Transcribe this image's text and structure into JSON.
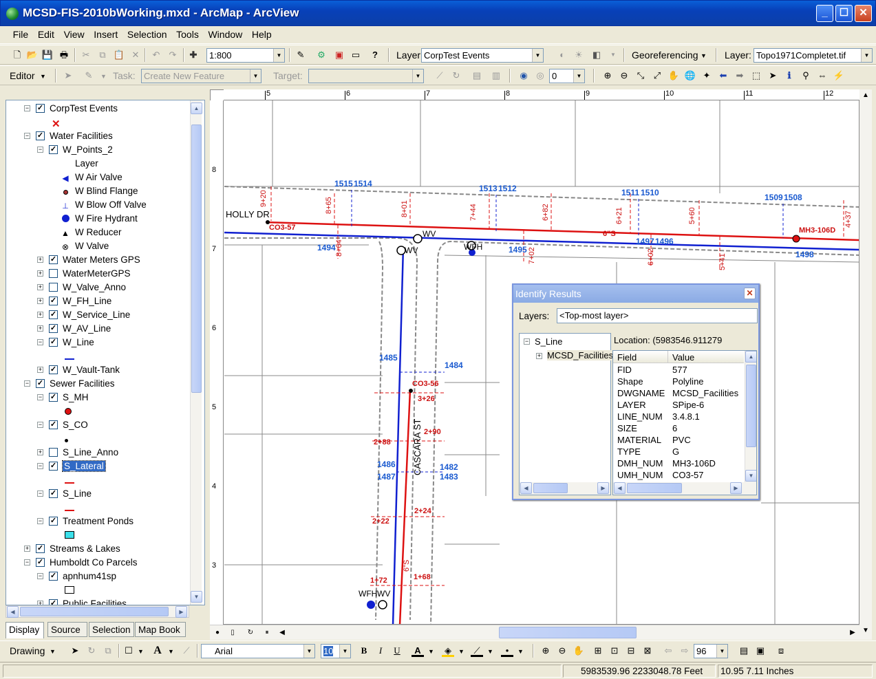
{
  "window": {
    "title": "MCSD-FIS-2010bWorking.mxd - ArcMap - ArcView"
  },
  "menu": [
    "File",
    "Edit",
    "View",
    "Insert",
    "Selection",
    "Tools",
    "Window",
    "Help"
  ],
  "standard_toolbar": {
    "scale": "1:800",
    "layer_label": "Layer",
    "layer_value": "CorpTest Events",
    "georef_label": "Georeferencing",
    "layer2_label": "Layer:",
    "layer2_value": "Topo1971Completet.tif"
  },
  "editor_toolbar": {
    "editor_label": "Editor",
    "task_label": "Task:",
    "task_value": "Create New Feature",
    "target_label": "Target:",
    "target_value": "",
    "snap_value": "0"
  },
  "toc": {
    "items": [
      {
        "label": "CorpTest Events",
        "level": 1,
        "expanded": true,
        "checked": true
      },
      {
        "label": "Water Facilities",
        "level": 1,
        "expanded": true,
        "checked": true
      },
      {
        "label": "W_Points_2",
        "level": 2,
        "expanded": true,
        "checked": true
      },
      {
        "label": "Layer",
        "level": 3,
        "legend": true
      },
      {
        "label": "W Air Valve",
        "level": 3,
        "legend": true
      },
      {
        "label": "W Blind Flange",
        "level": 3,
        "legend": true
      },
      {
        "label": "W Blow Off Valve",
        "level": 3,
        "legend": true
      },
      {
        "label": "W Fire Hydrant",
        "level": 3,
        "legend": true
      },
      {
        "label": "W Reducer",
        "level": 3,
        "legend": true
      },
      {
        "label": "W Valve",
        "level": 3,
        "legend": true
      },
      {
        "label": "Water Meters GPS",
        "level": 2,
        "expanded": false,
        "checked": true
      },
      {
        "label": "WaterMeterGPS",
        "level": 2,
        "expanded": false,
        "checked": false
      },
      {
        "label": "W_Valve_Anno",
        "level": 2,
        "expanded": false,
        "checked": false
      },
      {
        "label": "W_FH_Line",
        "level": 2,
        "expanded": false,
        "checked": true
      },
      {
        "label": "W_Service_Line",
        "level": 2,
        "expanded": false,
        "checked": true
      },
      {
        "label": "W_AV_Line",
        "level": 2,
        "expanded": false,
        "checked": true
      },
      {
        "label": "W_Line",
        "level": 2,
        "expanded": true,
        "checked": true
      },
      {
        "label": "W_Vault-Tank",
        "level": 2,
        "expanded": false,
        "checked": true
      },
      {
        "label": "Sewer Facilities",
        "level": 1,
        "expanded": true,
        "checked": true
      },
      {
        "label": "S_MH",
        "level": 2,
        "expanded": true,
        "checked": true
      },
      {
        "label": "S_CO",
        "level": 2,
        "expanded": true,
        "checked": true
      },
      {
        "label": "S_Line_Anno",
        "level": 2,
        "expanded": false,
        "checked": false
      },
      {
        "label": "S_Lateral",
        "level": 2,
        "expanded": true,
        "checked": true,
        "selected": true
      },
      {
        "label": "S_Line",
        "level": 2,
        "expanded": true,
        "checked": true
      },
      {
        "label": "Treatment Ponds",
        "level": 2,
        "expanded": true,
        "checked": true
      },
      {
        "label": "Streams & Lakes",
        "level": 1,
        "expanded": false,
        "checked": true
      },
      {
        "label": "Humboldt Co Parcels",
        "level": 1,
        "expanded": true,
        "checked": true
      },
      {
        "label": "apnhum41sp",
        "level": 2,
        "expanded": true,
        "checked": true
      },
      {
        "label": "Public Facilities",
        "level": 2,
        "expanded": false,
        "checked": true
      }
    ]
  },
  "toc_tabs": [
    "Display",
    "Source",
    "Selection",
    "Map Book"
  ],
  "ruler_top": [
    "5",
    "6",
    "7",
    "8",
    "9",
    "10",
    "11",
    "12"
  ],
  "ruler_left": [
    "8",
    "7",
    "6",
    "5",
    "4",
    "3"
  ],
  "map": {
    "labels_blue": [
      "1515",
      "1514",
      "1513",
      "1512",
      "1511",
      "1510",
      "1509",
      "1508",
      "1494",
      "1495",
      "1497",
      "1496",
      "1498",
      "1485",
      "1484",
      "1486",
      "1487",
      "1482",
      "1483"
    ],
    "labels_red": [
      "CO3-57",
      "6\"S",
      "MH3-106D",
      "CO3-56",
      "9+20",
      "8+65",
      "8+01",
      "7+44",
      "6+82",
      "6+21",
      "5+60",
      "4+37",
      "8+64",
      "7+02",
      "6+02",
      "5+41",
      "3+26",
      "2+88",
      "2+90",
      "2+24",
      "2+22",
      "1+72",
      "1+68",
      "6\"S"
    ],
    "labels_black": [
      "HOLLY DR",
      "CASCARA ST",
      "WV",
      "WV",
      "WFH",
      "WFH",
      "WV"
    ]
  },
  "identify": {
    "title": "Identify Results",
    "layers_label": "Layers:",
    "layers_value": "<Top-most layer>",
    "tree_root": "S_Line",
    "tree_child": "MCSD_Facilities",
    "location": "Location: (5983546.911279",
    "field_header": "Field",
    "value_header": "Value",
    "rows": [
      {
        "field": "FID",
        "value": "577"
      },
      {
        "field": "Shape",
        "value": "Polyline"
      },
      {
        "field": "DWGNAME",
        "value": "MCSD_Facilities"
      },
      {
        "field": "LAYER",
        "value": "SPipe-6"
      },
      {
        "field": "LINE_NUM",
        "value": "3.4.8.1"
      },
      {
        "field": "SIZE",
        "value": "6"
      },
      {
        "field": "MATERIAL",
        "value": "PVC"
      },
      {
        "field": "TYPE",
        "value": "G"
      },
      {
        "field": "DMH_NUM",
        "value": "MH3-106D"
      },
      {
        "field": "UMH_NUM",
        "value": "CO3-57"
      }
    ]
  },
  "drawing_toolbar": {
    "drawing_label": "Drawing",
    "font": "Arial",
    "size": "10",
    "zoom": "96"
  },
  "status": {
    "coords_map": "5983539.96  2233048.78 Feet",
    "coords_page": "10.95  7.11 Inches"
  }
}
